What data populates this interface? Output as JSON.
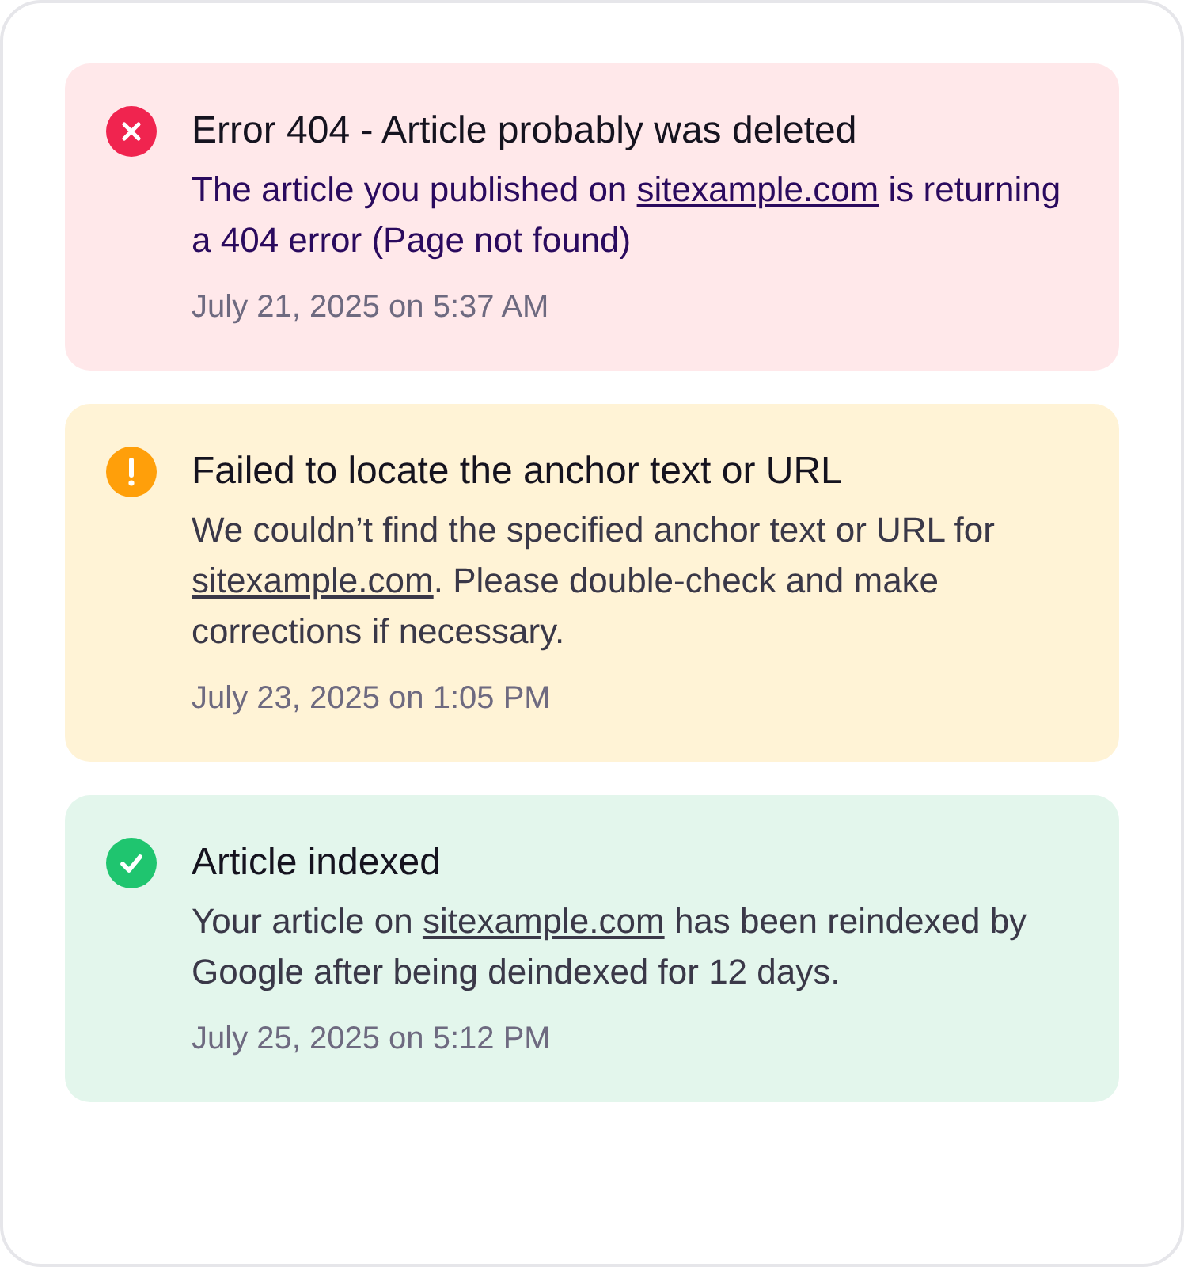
{
  "notifications": [
    {
      "kind": "error",
      "title": "Error 404 - Article probably was deleted",
      "body": {
        "before": "The article you published on",
        "link": "sitexample.com",
        "after": "is returning a 404 error (Page not found)"
      },
      "date": "July 21, 2025 on 5:37 AM"
    },
    {
      "kind": "warning",
      "title": "Failed to locate the anchor text or URL",
      "body": {
        "before": "We couldn’t find the specified anchor text or URL for",
        "link": "sitexample.com",
        "after": ". Please double-check and make corrections if necessary."
      },
      "date": "July 23, 2025 on 1:05 PM"
    },
    {
      "kind": "success",
      "title": "Article indexed",
      "body": {
        "before": "Your article on",
        "link": "sitexample.com",
        "after": "has been reindexed by Google after being deindexed for 12 days."
      },
      "date": "July 25, 2025 on 5:12 PM"
    }
  ]
}
